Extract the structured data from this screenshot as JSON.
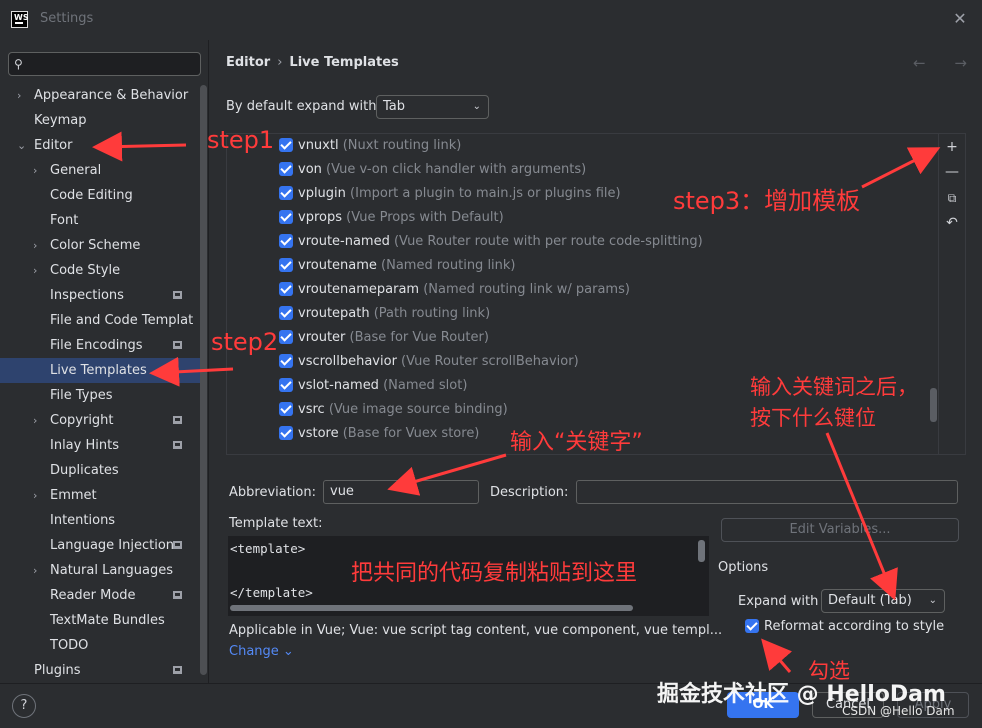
{
  "window": {
    "logo_text": "WS",
    "title": "Settings",
    "close_glyph": "✕"
  },
  "search": {
    "placeholder": ""
  },
  "sidebar": {
    "items": [
      {
        "label": "Appearance & Behavior",
        "chevron": "›"
      },
      {
        "label": "Keymap"
      },
      {
        "label": "Editor",
        "chevron": "⌄"
      },
      {
        "label": "General",
        "chevron": "›"
      },
      {
        "label": "Code Editing"
      },
      {
        "label": "Font"
      },
      {
        "label": "Color Scheme",
        "chevron": "›"
      },
      {
        "label": "Code Style",
        "chevron": "›"
      },
      {
        "label": "Inspections",
        "project": true
      },
      {
        "label": "File and Code Templat"
      },
      {
        "label": "File Encodings",
        "project": true
      },
      {
        "label": "Live Templates",
        "selected": true
      },
      {
        "label": "File Types"
      },
      {
        "label": "Copyright",
        "chevron": "›",
        "project": true
      },
      {
        "label": "Inlay Hints",
        "project": true
      },
      {
        "label": "Duplicates"
      },
      {
        "label": "Emmet",
        "chevron": "›"
      },
      {
        "label": "Intentions"
      },
      {
        "label": "Language Injections",
        "project": true
      },
      {
        "label": "Natural Languages",
        "chevron": "›"
      },
      {
        "label": "Reader Mode",
        "project": true
      },
      {
        "label": "TextMate Bundles"
      },
      {
        "label": "TODO"
      },
      {
        "label": "Plugins",
        "project": true
      }
    ]
  },
  "breadcrumb": {
    "parent": "Editor",
    "separator": "›",
    "current": "Live Templates",
    "nav": "← →"
  },
  "expand_default": {
    "label": "By default expand with",
    "value": "Tab",
    "dropdown_glyph": "⌄"
  },
  "templates": [
    {
      "key": "vnuxtl",
      "desc": "(Nuxt routing link)"
    },
    {
      "key": "von",
      "desc": "(Vue v-on click handler with arguments)"
    },
    {
      "key": "vplugin",
      "desc": "(Import a plugin to main.js or plugins file)"
    },
    {
      "key": "vprops",
      "desc": "(Vue Props with Default)"
    },
    {
      "key": "vroute-named",
      "desc": "(Vue Router route with per route code-splitting)"
    },
    {
      "key": "vroutename",
      "desc": "(Named routing link)"
    },
    {
      "key": "vroutenameparam",
      "desc": "(Named routing link w/ params)"
    },
    {
      "key": "vroutepath",
      "desc": "(Path routing link)"
    },
    {
      "key": "vrouter",
      "desc": "(Base for Vue Router)"
    },
    {
      "key": "vscrollbehavior",
      "desc": "(Vue Router scrollBehavior)"
    },
    {
      "key": "vslot-named",
      "desc": "(Named slot)"
    },
    {
      "key": "vsrc",
      "desc": "(Vue image source binding)"
    },
    {
      "key": "vstore",
      "desc": "(Base for Vuex store)"
    }
  ],
  "tools": {
    "add": "+",
    "remove": "—",
    "copy": "⧉",
    "restore": "↶"
  },
  "abbreviation": {
    "label": "Abbreviation:",
    "value": "vue"
  },
  "description": {
    "label": "Description:",
    "value": ""
  },
  "template_text": {
    "label": "Template text:",
    "line1": "<template>",
    "line2": "",
    "line3": "</template>"
  },
  "edit_variables": {
    "label": "Edit Variables..."
  },
  "applicable": {
    "text": "Applicable in Vue; Vue: vue script tag content, vue component, vue templ...",
    "change": "Change ⌄"
  },
  "options": {
    "title": "Options",
    "expand_label": "Expand with",
    "expand_value": "Default (Tab)",
    "reformat_label": "Reformat according to style",
    "reformat_checked": true
  },
  "footer": {
    "help": "?",
    "ok": "OK",
    "cancel": "Cancel",
    "apply": "Apply"
  },
  "annotations": {
    "step1": "step1",
    "step2": "step2",
    "step3": "step3：增加模板",
    "keyword": "输入“关键字”",
    "paste": "把共同的代码复制粘贴到这里",
    "after1": "输入关键词之后，",
    "after2": "按下什么键位",
    "check": "勾选"
  },
  "watermark": {
    "main": "掘金技术社区 @ HelloDam",
    "csdn": "CSDN @Hello Dam"
  },
  "colors": {
    "accent": "#3574f0",
    "annotation": "#ff3b3b",
    "selection": "#2e436e"
  }
}
